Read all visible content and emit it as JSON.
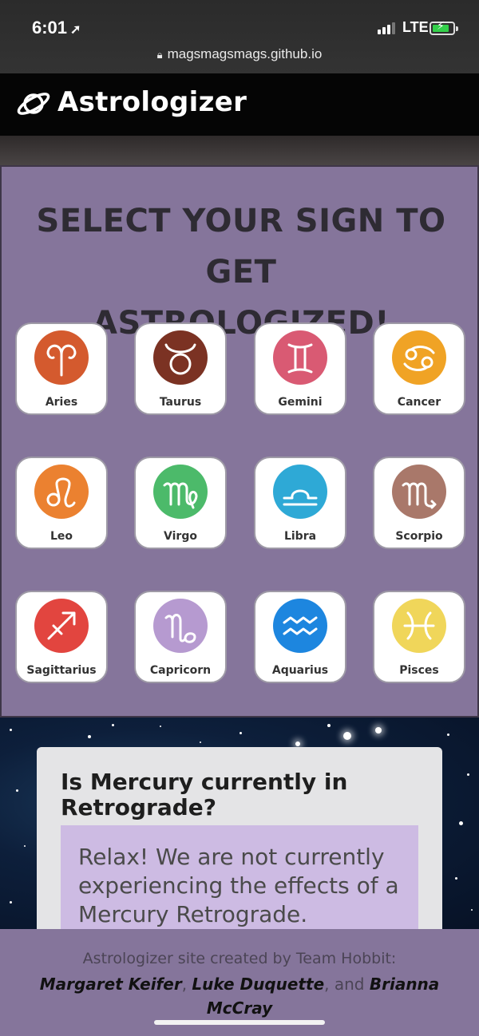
{
  "status_bar": {
    "time": "6:01",
    "network": "LTE",
    "url": "magsmagsmags.github.io"
  },
  "nav": {
    "brand": "Astrologizer",
    "logo_icon": "planet-icon"
  },
  "signs_section": {
    "title_line1": "SELECT YOUR SIGN TO GET",
    "title_line2": "ASTROLOGIZED!",
    "signs": [
      {
        "label": "Aries",
        "color": "#d45a2e"
      },
      {
        "label": "Taurus",
        "color": "#7b3223"
      },
      {
        "label": "Gemini",
        "color": "#d95a73"
      },
      {
        "label": "Cancer",
        "color": "#f0a325"
      },
      {
        "label": "Leo",
        "color": "#eb8130"
      },
      {
        "label": "Virgo",
        "color": "#4cba6a"
      },
      {
        "label": "Libra",
        "color": "#2ea9d6"
      },
      {
        "label": "Scorpio",
        "color": "#a9786a"
      },
      {
        "label": "Sagittarius",
        "color": "#e2453f"
      },
      {
        "label": "Capricorn",
        "color": "#b69ad0"
      },
      {
        "label": "Aquarius",
        "color": "#1d86df"
      },
      {
        "label": "Pisces",
        "color": "#f0d65a"
      }
    ]
  },
  "retrograde": {
    "question": "Is Mercury currently in Retrograde?",
    "answer": "Relax! We are not currently experiencing the effects of a Mercury Retrograde."
  },
  "footer": {
    "credit": "Astrologizer site created by Team Hobbit:",
    "author1": "Margaret Keifer",
    "sep1": ", ",
    "author2": "Luke Duquette",
    "sep2": ", and ",
    "author3": "Brianna McCray"
  },
  "colors": {
    "section_bg": "#85759b",
    "nav_bg": "#050505"
  }
}
